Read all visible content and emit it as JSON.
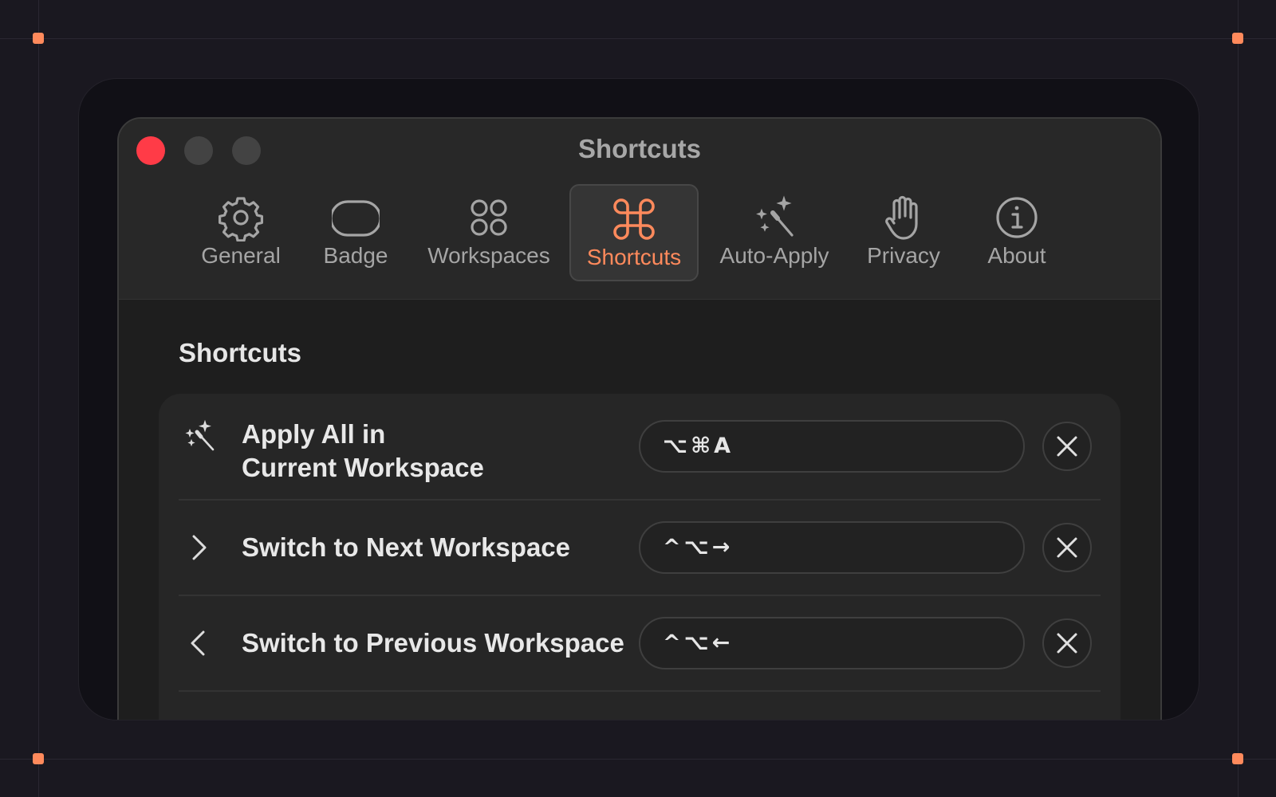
{
  "window": {
    "title": "Shortcuts"
  },
  "tabs": [
    {
      "label": "General",
      "icon": "gear-icon",
      "active": false
    },
    {
      "label": "Badge",
      "icon": "rounded-rect-icon",
      "active": false
    },
    {
      "label": "Workspaces",
      "icon": "four-circles-icon",
      "active": false
    },
    {
      "label": "Shortcuts",
      "icon": "command-icon",
      "active": true
    },
    {
      "label": "Auto-Apply",
      "icon": "magic-wand-icon",
      "active": false
    },
    {
      "label": "Privacy",
      "icon": "hand-icon",
      "active": false
    },
    {
      "label": "About",
      "icon": "info-icon",
      "active": false
    }
  ],
  "section": {
    "title": "Shortcuts"
  },
  "shortcuts": [
    {
      "line1": "Apply All in",
      "line2": "Current Workspace",
      "keys": "⌥⌘A",
      "icon": "magic-wand-icon"
    },
    {
      "label": "Switch to Next Workspace",
      "keys": "^⌥→",
      "icon": "chevron-right-icon"
    },
    {
      "label": "Switch to Previous Workspace",
      "keys": "^⌥←",
      "icon": "chevron-left-icon"
    }
  ],
  "colors": {
    "accent": "#ff8a5c",
    "close_button": "#ff3b47",
    "background": "#1a1820"
  }
}
